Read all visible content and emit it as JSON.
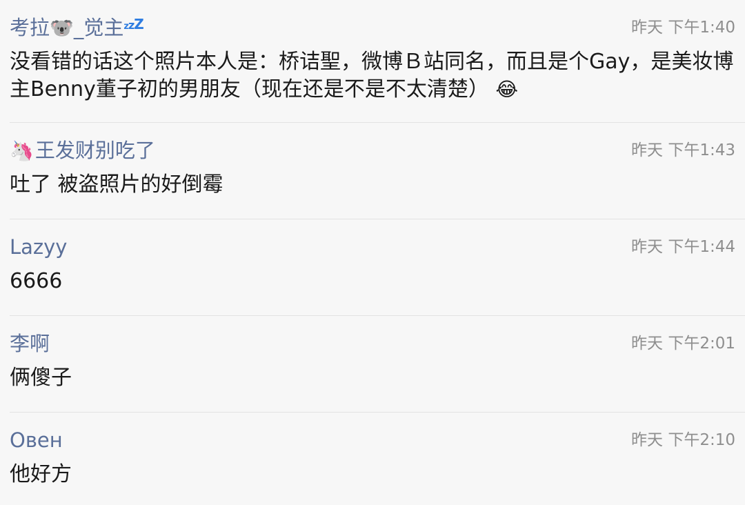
{
  "colors": {
    "background": "#f7f7f7",
    "author": "#5a6f99",
    "time": "#8e8e8e",
    "content": "#1a1a1a",
    "separator": "#e2e2e2",
    "zzz": "#2f7de1"
  },
  "comments": [
    {
      "author_prefix": "考拉",
      "author_emoji": "🐨",
      "author_suffix": "_觉主",
      "author_decoration": "sleeping-zzz-icon",
      "time": "昨天 下午1:40",
      "text": "没看错的话这个照片本人是：桥诘聖，微博Ｂ站同名，而且是个Gay，是美妆博主Benny董子初的男朋友（现在还是不是不太清楚）",
      "text_emoji": "😂"
    },
    {
      "author_emoji": "🦄",
      "author": "王发财别吃了",
      "time": "昨天 下午1:43",
      "text": "吐了 被盗照片的好倒霉"
    },
    {
      "author": "Lazyy",
      "time": "昨天 下午1:44",
      "text": "6666"
    },
    {
      "author": "李啊",
      "time": "昨天 下午2:01",
      "text": "俩傻子"
    },
    {
      "author": "Овен",
      "time": "昨天 下午2:10",
      "text": "他好方"
    }
  ]
}
